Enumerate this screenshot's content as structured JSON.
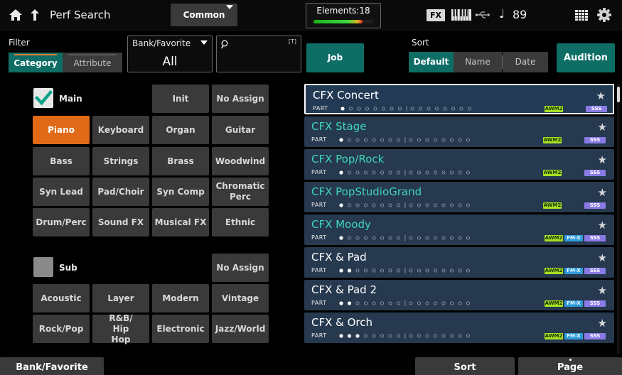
{
  "header": {
    "page_title": "Perf Search",
    "common_tab": "Common",
    "elements_label": "Elements:18",
    "elements_level": 0.82,
    "fx_label": "FX",
    "note_glyph": "♩",
    "tempo": "89",
    "icons": [
      "home-icon",
      "back-arrow-icon",
      "keyboard-icon",
      "usb-icon",
      "grid-icon",
      "gear-icon"
    ]
  },
  "filter": {
    "label": "Filter",
    "tabs": [
      "Category",
      "Attribute"
    ],
    "active_tab": "Category",
    "bank_label": "Bank/Favorite",
    "bank_value": "All",
    "search_keyboard_hint": "[T]",
    "search_value": "",
    "job_label": "Job"
  },
  "sort": {
    "label": "Sort",
    "options": [
      "Default",
      "Name",
      "Date"
    ],
    "active": "Default",
    "audition_label": "Audition"
  },
  "categories": {
    "main_label": "Main",
    "main_checked": true,
    "main_top_buttons": [
      "Init",
      "No Assign"
    ],
    "main_grid": [
      [
        "Piano",
        "Keyboard",
        "Organ",
        "Guitar"
      ],
      [
        "Bass",
        "Strings",
        "Brass",
        "Woodwind"
      ],
      [
        "Syn Lead",
        "Pad/Choir",
        "Syn Comp",
        "Chromatic Perc"
      ],
      [
        "Drum/Perc",
        "Sound FX",
        "Musical FX",
        "Ethnic"
      ]
    ],
    "selected_main": "Piano",
    "sub_label": "Sub",
    "sub_checked": false,
    "sub_top_button": "No Assign",
    "sub_grid": [
      [
        "Acoustic",
        "Layer",
        "Modern",
        "Vintage"
      ],
      [
        "Rock/Pop",
        "R&B/ Hip Hop",
        "Electronic",
        "Jazz/World"
      ]
    ]
  },
  "performances": {
    "part_label": "PART",
    "awm_label": "AWM2",
    "fm_label": "FM-X",
    "sss_label": "SSS",
    "star_glyph": "★",
    "items": [
      {
        "name": "CFX Concert",
        "parts": 1,
        "selected": true,
        "name_color": "#ffffff",
        "fm": false
      },
      {
        "name": "CFX Stage",
        "parts": 1,
        "selected": false,
        "name_color": "#3fd6b6",
        "fm": false
      },
      {
        "name": "CFX Pop/Rock",
        "parts": 1,
        "selected": false,
        "name_color": "#3fd6b6",
        "fm": false
      },
      {
        "name": "CFX PopStudioGrand",
        "parts": 1,
        "selected": false,
        "name_color": "#3fd6b6",
        "fm": false
      },
      {
        "name": "CFX Moody",
        "parts": 1,
        "selected": false,
        "name_color": "#3fd6b6",
        "fm": true
      },
      {
        "name": "CFX & Pad",
        "parts": 2,
        "selected": false,
        "name_color": "#ffffff",
        "fm": true
      },
      {
        "name": "CFX & Pad 2",
        "parts": 2,
        "selected": false,
        "name_color": "#ffffff",
        "fm": true
      },
      {
        "name": "CFX & Orch",
        "parts": 3,
        "selected": false,
        "name_color": "#ffffff",
        "fm": true
      }
    ]
  },
  "bottom": {
    "bank_favorite": "Bank/Favorite",
    "sort": "Sort",
    "page": "Page"
  },
  "colors": {
    "accent_teal": "#0e6e66",
    "selected_orange": "#e06a18",
    "row_blue": "#26394f"
  }
}
